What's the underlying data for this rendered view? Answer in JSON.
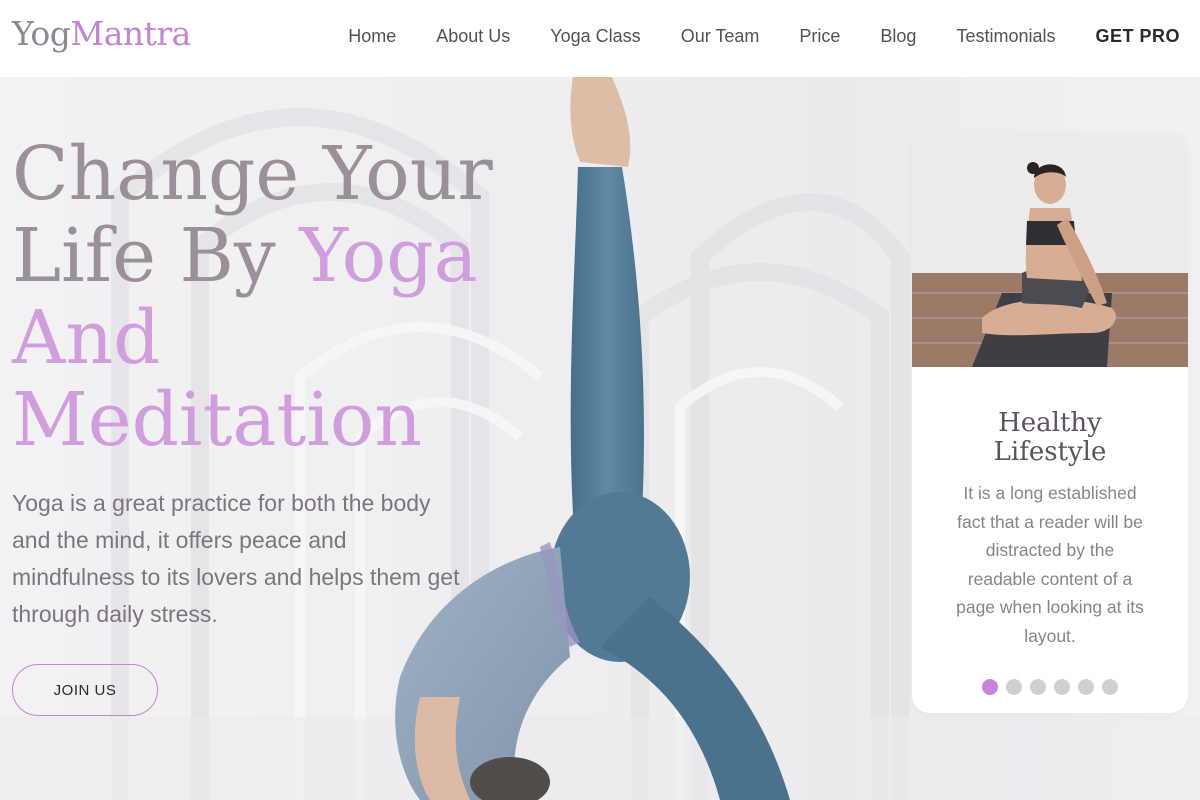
{
  "logo": {
    "part1": "Yog",
    "part2": "Mantra"
  },
  "nav": {
    "items": [
      "Home",
      "About Us",
      "Yoga Class",
      "Our Team",
      "Price",
      "Blog",
      "Testimonials"
    ],
    "cta": "GET PRO"
  },
  "hero": {
    "line1": "Change Your",
    "line2a": "Life By ",
    "line2b": "Yoga",
    "line3": "And",
    "line4": "Meditation",
    "description": "Yoga is a great practice for both the body and the mind, it offers peace and mindfulness to its lovers and helps them get through daily stress.",
    "join_label": "JOIN US"
  },
  "card": {
    "title_line1": "Healthy",
    "title_line2": "Lifestyle",
    "text": "It is a long established fact that a reader will be distracted by the readable content of a page when looking at its layout.",
    "slide_count": 6,
    "active_slide": 1
  },
  "colors": {
    "accent": "#c284d3",
    "headline": "#9b8f99",
    "headline_accent": "#d09ddd",
    "dot_inactive": "#cfcfd2"
  }
}
